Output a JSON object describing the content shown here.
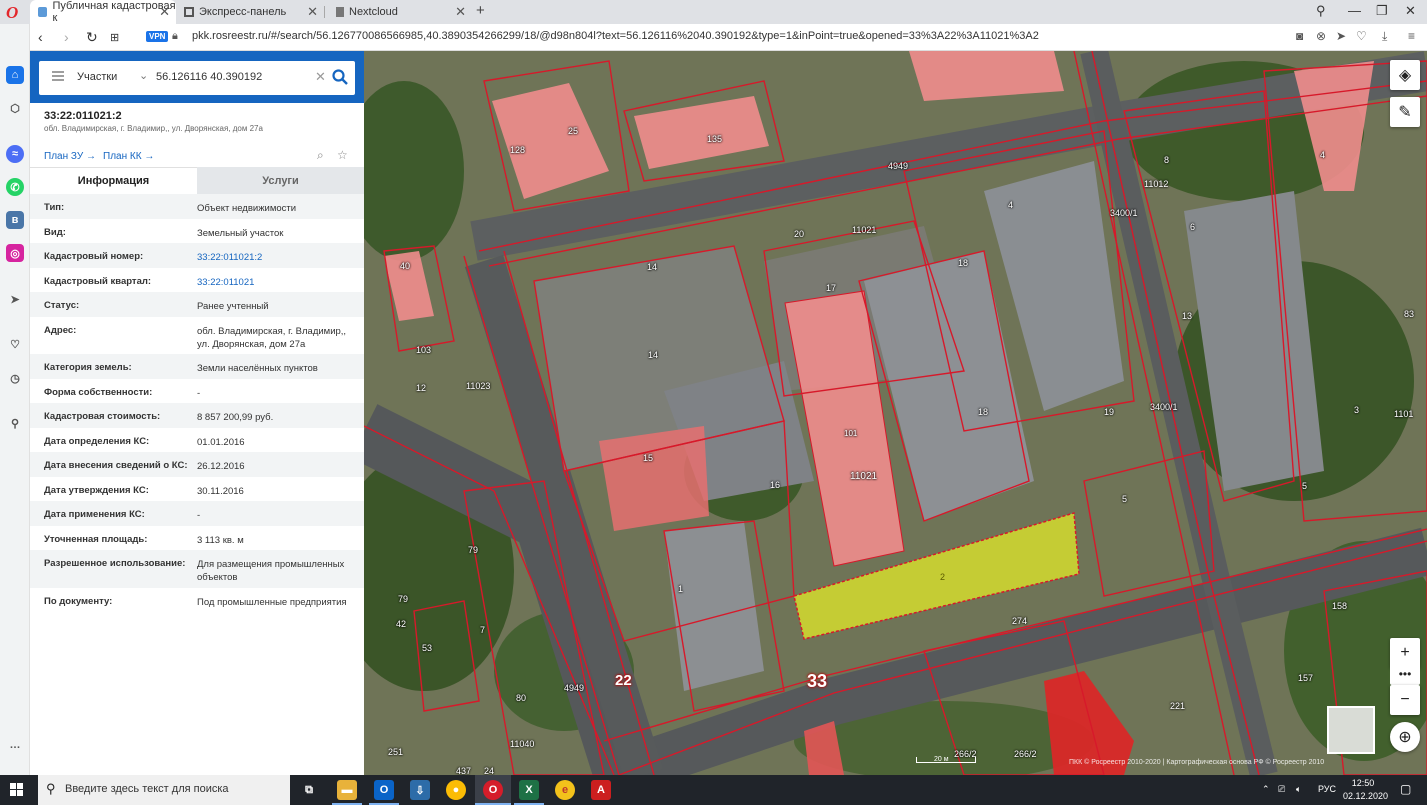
{
  "browser": {
    "tabs": [
      {
        "label": "Публичная кадастровая к",
        "active": true
      },
      {
        "label": "Экспресс-панель",
        "active": false
      },
      {
        "label": "Nextcloud",
        "active": false
      }
    ],
    "vpn_label": "VPN",
    "url": "pkk.rosreestr.ru/#/search/56.126770086566985,40.3890354266299/18/@d98n804l?text=56.126116%2040.390192&type=1&inPoint=true&opened=33%3A22%3A11021%3A2"
  },
  "panel": {
    "search": {
      "type_label": "Участки",
      "query": "56.126116 40.390192"
    },
    "object": {
      "cadastral_number": "33:22:011021:2",
      "address_short": "обл. Владимирская, г. Владимир,, ул. Дворянская, дом 27а",
      "plan_zu": "План ЗУ →",
      "plan_kk": "План КК →"
    },
    "tabs": {
      "info": "Информация",
      "services": "Услуги"
    },
    "rows": [
      {
        "k": "Тип:",
        "v": "Объект недвижимости",
        "link": false
      },
      {
        "k": "Вид:",
        "v": "Земельный участок",
        "link": false
      },
      {
        "k": "Кадастровый номер:",
        "v": "33:22:011021:2",
        "link": true
      },
      {
        "k": "Кадастровый квартал:",
        "v": "33:22:011021",
        "link": true
      },
      {
        "k": "Статус:",
        "v": "Ранее учтенный",
        "link": false
      },
      {
        "k": "Адрес:",
        "v": "обл. Владимирская, г. Владимир,, ул. Дворянская, дом 27а",
        "link": false
      },
      {
        "k": "Категория земель:",
        "v": "Земли населённых пунктов",
        "link": false
      },
      {
        "k": "Форма собственности:",
        "v": "-",
        "link": false
      },
      {
        "k": "Кадастровая стоимость:",
        "v": "8 857 200,99 руб.",
        "link": false
      },
      {
        "k": "Дата определения КС:",
        "v": "01.01.2016",
        "link": false
      },
      {
        "k": "Дата внесения сведений о КС:",
        "v": "26.12.2016",
        "link": false
      },
      {
        "k": "Дата утверждения КС:",
        "v": "30.11.2016",
        "link": false
      },
      {
        "k": "Дата применения КС:",
        "v": "-",
        "link": false
      },
      {
        "k": "Уточненная площадь:",
        "v": "3 113 кв. м",
        "link": false
      },
      {
        "k": "Разрешенное использование:",
        "v": "Для размещения промышленных объектов",
        "link": false
      },
      {
        "k": "По документу:",
        "v": "Под промышленные предприятия",
        "link": false
      }
    ]
  },
  "map": {
    "labels": {
      "q11021": "11021",
      "q11023": "11023",
      "q11012": "11012",
      "q11040": "11040",
      "big33": "33",
      "big22": "22",
      "big22r": "22",
      "n274": "274",
      "n4949a": "4949",
      "n4949b": "4949",
      "n3400a": "3400/1",
      "n3400b": "3400/1",
      "n17": "17",
      "n18": "18",
      "n20": "20",
      "n14a": "14",
      "n14b": "14",
      "n15": "15",
      "n16": "16",
      "n135": "135",
      "n128": "128",
      "n25": "25",
      "n8": "8",
      "n6": "6",
      "n4": "4",
      "n221": "221",
      "n158": "158",
      "n157": "157",
      "n80": "80",
      "n79": "79",
      "n7": "7",
      "n266a": "266/2",
      "n266b": "266/2",
      "n2": "2",
      "n101": "101",
      "n11021b": "11021",
      "n19": "19",
      "n5": "5",
      "n13": "13",
      "n3": "3",
      "n40": "40",
      "n103": "103",
      "n12": "12",
      "n42": "42",
      "n53": "53",
      "n251": "251",
      "n24": "24",
      "n437": "437",
      "n1101": "1101",
      "n83": "83",
      "n1": "1"
    },
    "scale_label": "20 м",
    "copyright": "ПКК © Росреестр 2010-2020 | Картографическая основа РФ © Росреестр 2010"
  },
  "taskbar": {
    "search_placeholder": "Введите здесь текст для поиска",
    "lang": "РУС",
    "time": "12:50",
    "date": "02.12.2020"
  },
  "colors": {
    "accent": "#1565c0",
    "parcel_selected": "#e2ea28",
    "parcel_border": "#d7192a",
    "building": "#f08080"
  }
}
